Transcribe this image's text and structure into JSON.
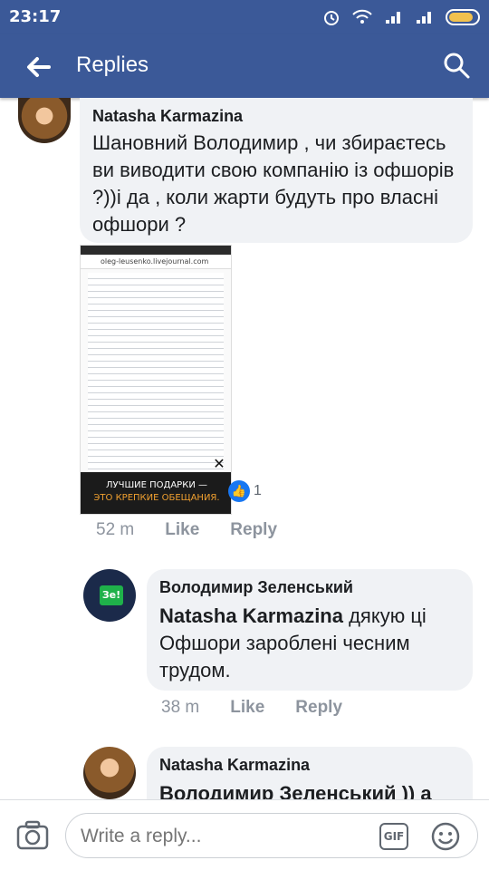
{
  "status": {
    "time": "23:17"
  },
  "app": {
    "title": "Replies"
  },
  "comments": [
    {
      "author": "Natasha Karmazina",
      "text": "Шановний Володимир , чи збираєтесь ви виводити свою компанію із  офшорів ?))і да , коли жарти будуть про власні офшори ?",
      "attachment": {
        "url": "oleg-leusenko.livejournal.com",
        "banner_line1": "ЛУЧШИЕ ПОДАРКИ —",
        "banner_line2": "ЭТО КРЕПКИЕ ОБЕЩАНИЯ."
      },
      "reactions": "1",
      "time": "52 m",
      "like": "Like",
      "reply": "Reply"
    },
    {
      "author": "Володимир Зеленський",
      "mention": "Natasha Karmazina",
      "text": " дякую ці Офшори зароблені чесним трудом.",
      "time": "38 m",
      "like": "Like",
      "reply": "Reply"
    },
    {
      "author": "Natasha Karmazina",
      "text": "Володимир Зеленський )) а"
    }
  ],
  "composer": {
    "placeholder": "Write a reply...",
    "gif_label": "GIF"
  },
  "colors": {
    "brand": "#3b5998",
    "bubble": "#f0f2f5"
  }
}
